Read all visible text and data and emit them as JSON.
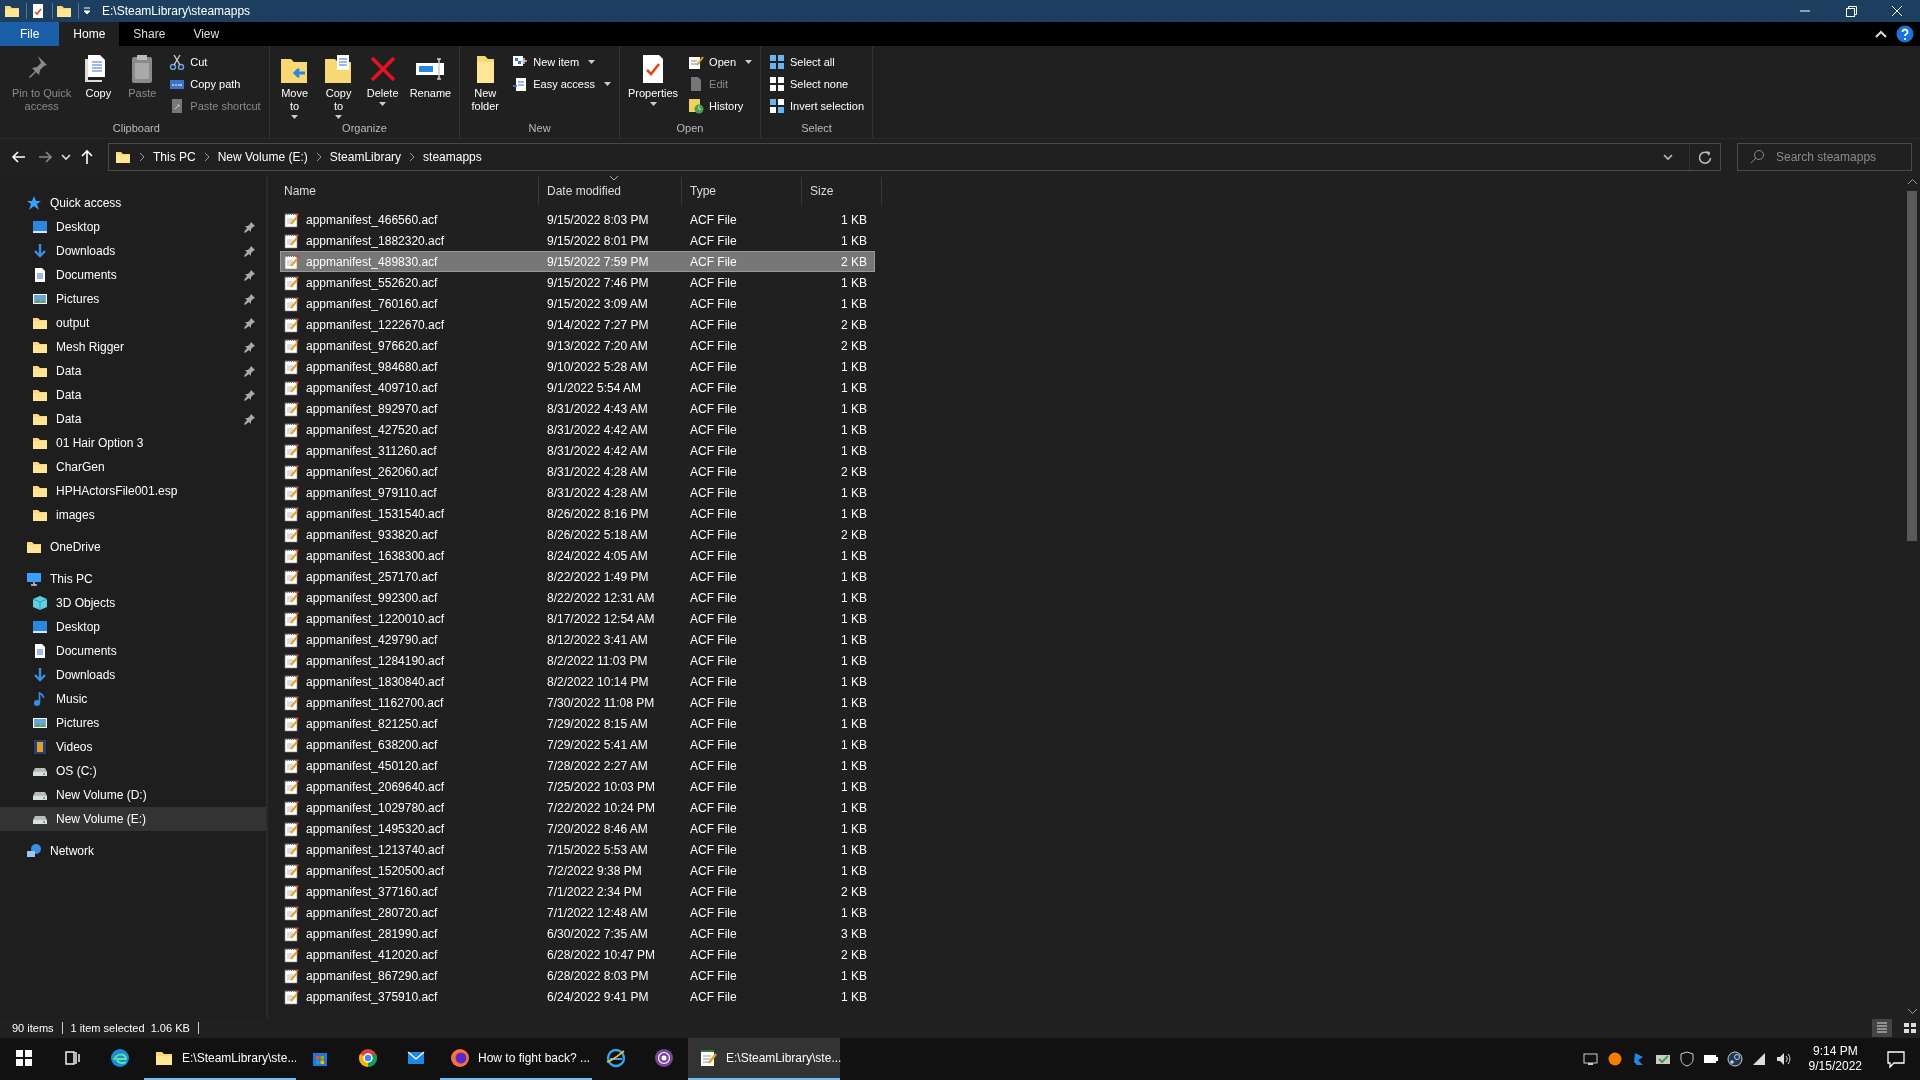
{
  "window": {
    "title": "E:\\SteamLibrary\\steamapps"
  },
  "ribbon_tabs": [
    {
      "label": "File",
      "kind": "menu",
      "selected": false
    },
    {
      "label": "Home",
      "kind": "tab",
      "selected": true
    },
    {
      "label": "Share",
      "kind": "tab",
      "selected": false
    },
    {
      "label": "View",
      "kind": "tab",
      "selected": false
    }
  ],
  "ribbon_groups": [
    {
      "label": "Clipboard",
      "items": [
        {
          "label": "Pin to Quick\naccess",
          "kind": "large",
          "disabled": true,
          "dropdown": false
        },
        {
          "label": "Copy",
          "kind": "large",
          "disabled": false,
          "dropdown": false
        },
        {
          "label": "Paste",
          "kind": "large",
          "disabled": true,
          "dropdown": false
        },
        {
          "label": "Cut",
          "kind": "small",
          "disabled": false,
          "dropdown": false
        },
        {
          "label": "Copy path",
          "kind": "small",
          "disabled": false,
          "dropdown": false
        },
        {
          "label": "Paste shortcut",
          "kind": "small",
          "disabled": true,
          "dropdown": false
        }
      ]
    },
    {
      "label": "Organize",
      "items": [
        {
          "label": "Move\nto",
          "kind": "large",
          "disabled": false,
          "dropdown": true
        },
        {
          "label": "Copy\nto",
          "kind": "large",
          "disabled": false,
          "dropdown": true
        },
        {
          "label": "Delete",
          "kind": "large",
          "disabled": false,
          "dropdown": true
        },
        {
          "label": "Rename",
          "kind": "large",
          "disabled": false,
          "dropdown": false
        }
      ]
    },
    {
      "label": "New",
      "items": [
        {
          "label": "New\nfolder",
          "kind": "large",
          "disabled": false,
          "dropdown": false
        },
        {
          "label": "New item",
          "kind": "small",
          "disabled": false,
          "dropdown": true
        },
        {
          "label": "Easy access",
          "kind": "small",
          "disabled": false,
          "dropdown": true
        }
      ]
    },
    {
      "label": "Open",
      "items": [
        {
          "label": "Properties",
          "kind": "large",
          "disabled": false,
          "dropdown": true
        },
        {
          "label": "Open",
          "kind": "small",
          "disabled": false,
          "dropdown": true
        },
        {
          "label": "Edit",
          "kind": "small",
          "disabled": true,
          "dropdown": false
        },
        {
          "label": "History",
          "kind": "small",
          "disabled": false,
          "dropdown": false
        }
      ]
    },
    {
      "label": "Select",
      "items": [
        {
          "label": "Select all",
          "kind": "small",
          "disabled": false,
          "dropdown": false
        },
        {
          "label": "Select none",
          "kind": "small",
          "disabled": false,
          "dropdown": false
        },
        {
          "label": "Invert selection",
          "kind": "small",
          "disabled": false,
          "dropdown": false
        }
      ]
    }
  ],
  "address_bar": {
    "breadcrumbs": [
      "This PC",
      "New Volume (E:)",
      "SteamLibrary",
      "steamapps"
    ]
  },
  "search": {
    "placeholder": "Search steamapps"
  },
  "sidebar": {
    "sections": [
      {
        "label": "Quick access",
        "kind": "star",
        "selected": false,
        "children": [
          {
            "label": "Desktop",
            "kind": "desktop",
            "pinned": true,
            "selected": false
          },
          {
            "label": "Downloads",
            "kind": "downloads",
            "pinned": true,
            "selected": false
          },
          {
            "label": "Documents",
            "kind": "documents",
            "pinned": true,
            "selected": false
          },
          {
            "label": "Pictures",
            "kind": "pictures",
            "pinned": true,
            "selected": false
          },
          {
            "label": "output",
            "kind": "folder",
            "pinned": true,
            "selected": false
          },
          {
            "label": "Mesh Rigger",
            "kind": "folder",
            "pinned": true,
            "selected": false
          },
          {
            "label": "Data",
            "kind": "folder",
            "pinned": true,
            "selected": false
          },
          {
            "label": "Data",
            "kind": "folder",
            "pinned": true,
            "selected": false
          },
          {
            "label": "Data",
            "kind": "folder",
            "pinned": true,
            "selected": false
          },
          {
            "label": "01 Hair Option 3",
            "kind": "folder",
            "pinned": false,
            "selected": false
          },
          {
            "label": "CharGen",
            "kind": "folder",
            "pinned": false,
            "selected": false
          },
          {
            "label": "HPHActorsFile001.esp",
            "kind": "folder",
            "pinned": false,
            "selected": false
          },
          {
            "label": "images",
            "kind": "folder",
            "pinned": false,
            "selected": false
          }
        ]
      },
      {
        "label": "OneDrive",
        "kind": "folder",
        "selected": false
      },
      {
        "label": "This PC",
        "kind": "pc",
        "selected": false,
        "children": [
          {
            "label": "3D Objects",
            "kind": "objects",
            "selected": false
          },
          {
            "label": "Desktop",
            "kind": "desktop",
            "selected": false
          },
          {
            "label": "Documents",
            "kind": "documents",
            "selected": false
          },
          {
            "label": "Downloads",
            "kind": "downloads",
            "selected": false
          },
          {
            "label": "Music",
            "kind": "music",
            "selected": false
          },
          {
            "label": "Pictures",
            "kind": "pictures",
            "selected": false
          },
          {
            "label": "Videos",
            "kind": "videos",
            "selected": false
          },
          {
            "label": "OS (C:)",
            "kind": "drive",
            "selected": false
          },
          {
            "label": "New Volume (D:)",
            "kind": "drive",
            "selected": false
          },
          {
            "label": "New Volume (E:)",
            "kind": "drive",
            "selected": true
          }
        ]
      },
      {
        "label": "Network",
        "kind": "network",
        "selected": false
      }
    ]
  },
  "file_list": {
    "columns": [
      {
        "label": "Name",
        "sorted": false
      },
      {
        "label": "Date modified",
        "sorted": true
      },
      {
        "label": "Type",
        "sorted": false
      },
      {
        "label": "Size",
        "sorted": false
      }
    ],
    "rows": [
      {
        "name": "appmanifest_466560.acf",
        "date": "9/15/2022 8:03 PM",
        "type": "ACF File",
        "size": "1 KB",
        "selected": false
      },
      {
        "name": "appmanifest_1882320.acf",
        "date": "9/15/2022 8:01 PM",
        "type": "ACF File",
        "size": "1 KB",
        "selected": false
      },
      {
        "name": "appmanifest_489830.acf",
        "date": "9/15/2022 7:59 PM",
        "type": "ACF File",
        "size": "2 KB",
        "selected": true
      },
      {
        "name": "appmanifest_552620.acf",
        "date": "9/15/2022 7:46 PM",
        "type": "ACF File",
        "size": "1 KB",
        "selected": false
      },
      {
        "name": "appmanifest_760160.acf",
        "date": "9/15/2022 3:09 AM",
        "type": "ACF File",
        "size": "1 KB",
        "selected": false
      },
      {
        "name": "appmanifest_1222670.acf",
        "date": "9/14/2022 7:27 PM",
        "type": "ACF File",
        "size": "2 KB",
        "selected": false
      },
      {
        "name": "appmanifest_976620.acf",
        "date": "9/13/2022 7:20 AM",
        "type": "ACF File",
        "size": "2 KB",
        "selected": false
      },
      {
        "name": "appmanifest_984680.acf",
        "date": "9/10/2022 5:28 AM",
        "type": "ACF File",
        "size": "1 KB",
        "selected": false
      },
      {
        "name": "appmanifest_409710.acf",
        "date": "9/1/2022 5:54 AM",
        "type": "ACF File",
        "size": "1 KB",
        "selected": false
      },
      {
        "name": "appmanifest_892970.acf",
        "date": "8/31/2022 4:43 AM",
        "type": "ACF File",
        "size": "1 KB",
        "selected": false
      },
      {
        "name": "appmanifest_427520.acf",
        "date": "8/31/2022 4:42 AM",
        "type": "ACF File",
        "size": "1 KB",
        "selected": false
      },
      {
        "name": "appmanifest_311260.acf",
        "date": "8/31/2022 4:42 AM",
        "type": "ACF File",
        "size": "1 KB",
        "selected": false
      },
      {
        "name": "appmanifest_262060.acf",
        "date": "8/31/2022 4:28 AM",
        "type": "ACF File",
        "size": "2 KB",
        "selected": false
      },
      {
        "name": "appmanifest_979110.acf",
        "date": "8/31/2022 4:28 AM",
        "type": "ACF File",
        "size": "1 KB",
        "selected": false
      },
      {
        "name": "appmanifest_1531540.acf",
        "date": "8/26/2022 8:16 PM",
        "type": "ACF File",
        "size": "1 KB",
        "selected": false
      },
      {
        "name": "appmanifest_933820.acf",
        "date": "8/26/2022 5:18 AM",
        "type": "ACF File",
        "size": "2 KB",
        "selected": false
      },
      {
        "name": "appmanifest_1638300.acf",
        "date": "8/24/2022 4:05 AM",
        "type": "ACF File",
        "size": "1 KB",
        "selected": false
      },
      {
        "name": "appmanifest_257170.acf",
        "date": "8/22/2022 1:49 PM",
        "type": "ACF File",
        "size": "1 KB",
        "selected": false
      },
      {
        "name": "appmanifest_992300.acf",
        "date": "8/22/2022 12:31 AM",
        "type": "ACF File",
        "size": "1 KB",
        "selected": false
      },
      {
        "name": "appmanifest_1220010.acf",
        "date": "8/17/2022 12:54 AM",
        "type": "ACF File",
        "size": "1 KB",
        "selected": false
      },
      {
        "name": "appmanifest_429790.acf",
        "date": "8/12/2022 3:41 AM",
        "type": "ACF File",
        "size": "1 KB",
        "selected": false
      },
      {
        "name": "appmanifest_1284190.acf",
        "date": "8/2/2022 11:03 PM",
        "type": "ACF File",
        "size": "1 KB",
        "selected": false
      },
      {
        "name": "appmanifest_1830840.acf",
        "date": "8/2/2022 10:14 PM",
        "type": "ACF File",
        "size": "1 KB",
        "selected": false
      },
      {
        "name": "appmanifest_1162700.acf",
        "date": "7/30/2022 11:08 PM",
        "type": "ACF File",
        "size": "1 KB",
        "selected": false
      },
      {
        "name": "appmanifest_821250.acf",
        "date": "7/29/2022 8:15 AM",
        "type": "ACF File",
        "size": "1 KB",
        "selected": false
      },
      {
        "name": "appmanifest_638200.acf",
        "date": "7/29/2022 5:41 AM",
        "type": "ACF File",
        "size": "1 KB",
        "selected": false
      },
      {
        "name": "appmanifest_450120.acf",
        "date": "7/28/2022 2:27 AM",
        "type": "ACF File",
        "size": "1 KB",
        "selected": false
      },
      {
        "name": "appmanifest_2069640.acf",
        "date": "7/25/2022 10:03 PM",
        "type": "ACF File",
        "size": "1 KB",
        "selected": false
      },
      {
        "name": "appmanifest_1029780.acf",
        "date": "7/22/2022 10:24 PM",
        "type": "ACF File",
        "size": "1 KB",
        "selected": false
      },
      {
        "name": "appmanifest_1495320.acf",
        "date": "7/20/2022 8:46 AM",
        "type": "ACF File",
        "size": "1 KB",
        "selected": false
      },
      {
        "name": "appmanifest_1213740.acf",
        "date": "7/15/2022 5:53 AM",
        "type": "ACF File",
        "size": "1 KB",
        "selected": false
      },
      {
        "name": "appmanifest_1520500.acf",
        "date": "7/2/2022 9:38 PM",
        "type": "ACF File",
        "size": "1 KB",
        "selected": false
      },
      {
        "name": "appmanifest_377160.acf",
        "date": "7/1/2022 2:34 PM",
        "type": "ACF File",
        "size": "2 KB",
        "selected": false
      },
      {
        "name": "appmanifest_280720.acf",
        "date": "7/1/2022 12:48 AM",
        "type": "ACF File",
        "size": "1 KB",
        "selected": false
      },
      {
        "name": "appmanifest_281990.acf",
        "date": "6/30/2022 7:35 AM",
        "type": "ACF File",
        "size": "3 KB",
        "selected": false
      },
      {
        "name": "appmanifest_412020.acf",
        "date": "6/28/2022 10:47 PM",
        "type": "ACF File",
        "size": "2 KB",
        "selected": false
      },
      {
        "name": "appmanifest_867290.acf",
        "date": "6/28/2022 8:03 PM",
        "type": "ACF File",
        "size": "1 KB",
        "selected": false
      },
      {
        "name": "appmanifest_375910.acf",
        "date": "6/24/2022 9:41 PM",
        "type": "ACF File",
        "size": "1 KB",
        "selected": false
      }
    ]
  },
  "status_bar": {
    "item_count": "90 items",
    "selection": "1 item selected  1.06 KB",
    "views": [
      {
        "kind": "details",
        "selected": true
      },
      {
        "kind": "tiles",
        "selected": false
      }
    ]
  },
  "taskbar": {
    "items": [
      {
        "kind": "start",
        "running": false,
        "active": false
      },
      {
        "kind": "taskview",
        "running": false,
        "active": false
      },
      {
        "kind": "app",
        "running": false,
        "active": false
      },
      {
        "kind": "app",
        "label": "E:\\SteamLibrary\\ste...",
        "running": true,
        "active": false
      },
      {
        "kind": "app",
        "running": false,
        "active": false
      },
      {
        "kind": "app",
        "running": false,
        "active": false
      },
      {
        "kind": "app",
        "running": false,
        "active": false
      },
      {
        "kind": "app",
        "label": "How to fight back? ...",
        "running": true,
        "active": false
      },
      {
        "kind": "app",
        "running": false,
        "active": false
      },
      {
        "kind": "app",
        "running": false,
        "active": false
      },
      {
        "kind": "app",
        "label": "E:\\SteamLibrary\\ste...",
        "running": true,
        "active": true
      }
    ],
    "clock": {
      "time": "9:14 PM",
      "date": "9/15/2022"
    }
  }
}
